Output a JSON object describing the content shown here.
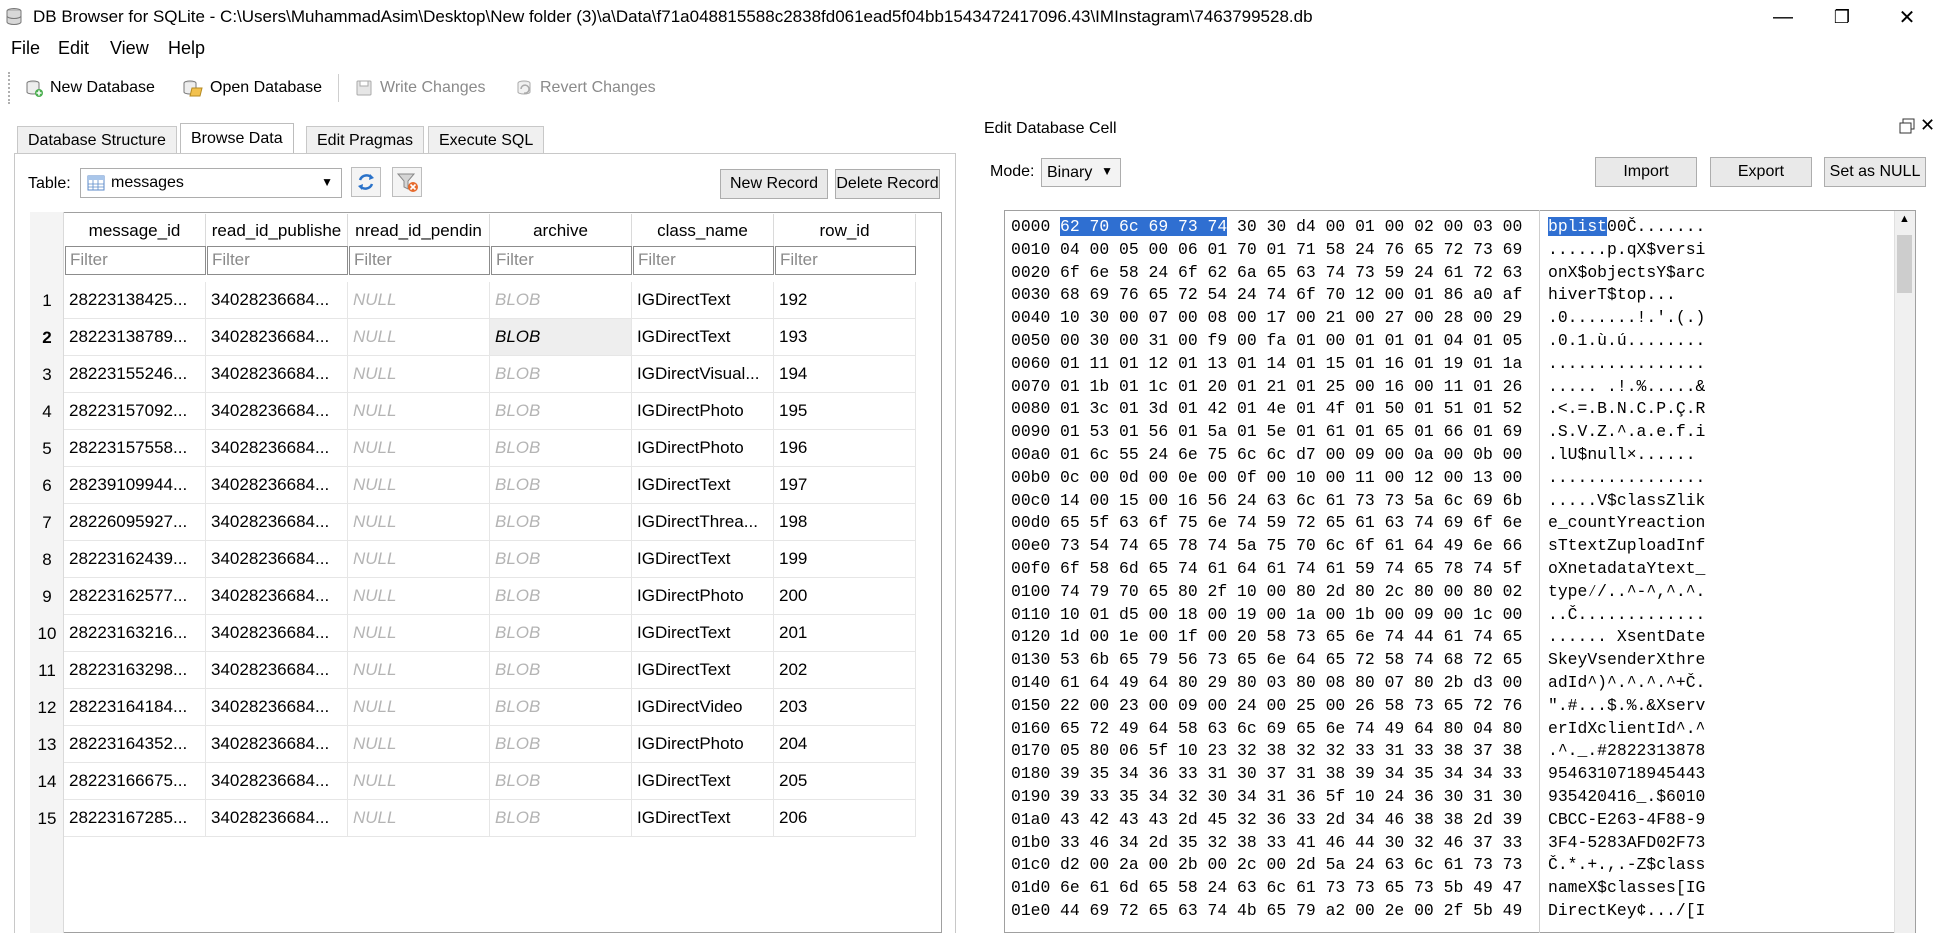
{
  "window": {
    "title": "DB Browser for SQLite - C:\\Users\\MuhammadAsim\\Desktop\\New folder (3)\\a\\Data\\f71a048815588c2838fd061ead5f04bb1543472417096.43\\IMInstagram\\7463799528.db",
    "minimize": "—",
    "maximize": "❐",
    "close": "✕"
  },
  "menu": {
    "file": "File",
    "edit": "Edit",
    "view": "View",
    "help": "Help"
  },
  "toolbar": {
    "new_database": "New Database",
    "open_database": "Open Database",
    "write_changes": "Write Changes",
    "revert_changes": "Revert Changes"
  },
  "tabs": {
    "structure": "Database Structure",
    "browse": "Browse Data",
    "pragmas": "Edit Pragmas",
    "sql": "Execute SQL"
  },
  "browse": {
    "table_label": "Table:",
    "table_value": "messages",
    "new_record": "New Record",
    "delete_record": "Delete Record",
    "columns": [
      "message_id",
      "read_id_publishe",
      "nread_id_pendin",
      "archive",
      "class_name",
      "row_id"
    ],
    "filter_placeholder": "Filter",
    "rows": [
      {
        "n": "1",
        "message_id": "28223138425...",
        "read_id": "34028236684...",
        "pending": "NULL",
        "archive": "BLOB",
        "class_name": "IGDirectText",
        "row_id": "192"
      },
      {
        "n": "2",
        "message_id": "28223138789...",
        "read_id": "34028236684...",
        "pending": "NULL",
        "archive": "BLOB",
        "class_name": "IGDirectText",
        "row_id": "193"
      },
      {
        "n": "3",
        "message_id": "28223155246...",
        "read_id": "34028236684...",
        "pending": "NULL",
        "archive": "BLOB",
        "class_name": "IGDirectVisual...",
        "row_id": "194"
      },
      {
        "n": "4",
        "message_id": "28223157092...",
        "read_id": "34028236684...",
        "pending": "NULL",
        "archive": "BLOB",
        "class_name": "IGDirectPhoto",
        "row_id": "195"
      },
      {
        "n": "5",
        "message_id": "28223157558...",
        "read_id": "34028236684...",
        "pending": "NULL",
        "archive": "BLOB",
        "class_name": "IGDirectPhoto",
        "row_id": "196"
      },
      {
        "n": "6",
        "message_id": "28239109944...",
        "read_id": "34028236684...",
        "pending": "NULL",
        "archive": "BLOB",
        "class_name": "IGDirectText",
        "row_id": "197"
      },
      {
        "n": "7",
        "message_id": "28226095927...",
        "read_id": "34028236684...",
        "pending": "NULL",
        "archive": "BLOB",
        "class_name": "IGDirectThrea...",
        "row_id": "198"
      },
      {
        "n": "8",
        "message_id": "28223162439...",
        "read_id": "34028236684...",
        "pending": "NULL",
        "archive": "BLOB",
        "class_name": "IGDirectText",
        "row_id": "199"
      },
      {
        "n": "9",
        "message_id": "28223162577...",
        "read_id": "34028236684...",
        "pending": "NULL",
        "archive": "BLOB",
        "class_name": "IGDirectPhoto",
        "row_id": "200"
      },
      {
        "n": "10",
        "message_id": "28223163216...",
        "read_id": "34028236684...",
        "pending": "NULL",
        "archive": "BLOB",
        "class_name": "IGDirectText",
        "row_id": "201"
      },
      {
        "n": "11",
        "message_id": "28223163298...",
        "read_id": "34028236684...",
        "pending": "NULL",
        "archive": "BLOB",
        "class_name": "IGDirectText",
        "row_id": "202"
      },
      {
        "n": "12",
        "message_id": "28223164184...",
        "read_id": "34028236684...",
        "pending": "NULL",
        "archive": "BLOB",
        "class_name": "IGDirectVideo",
        "row_id": "203"
      },
      {
        "n": "13",
        "message_id": "28223164352...",
        "read_id": "34028236684...",
        "pending": "NULL",
        "archive": "BLOB",
        "class_name": "IGDirectPhoto",
        "row_id": "204"
      },
      {
        "n": "14",
        "message_id": "28223166675...",
        "read_id": "34028236684...",
        "pending": "NULL",
        "archive": "BLOB",
        "class_name": "IGDirectText",
        "row_id": "205"
      },
      {
        "n": "15",
        "message_id": "28223167285...",
        "read_id": "34028236684...",
        "pending": "NULL",
        "archive": "BLOB",
        "class_name": "IGDirectText",
        "row_id": "206"
      }
    ],
    "current_row": "2"
  },
  "edit_cell": {
    "title": "Edit Database Cell",
    "mode_label": "Mode:",
    "mode_value": "Binary",
    "import": "Import",
    "export": "Export",
    "set_null": "Set as NULL",
    "hex": [
      {
        "addr": "0000",
        "sel": "62 70 6c 69 73 74",
        "bytes": " 30 30 d4 00 01 00 02 00 03 00",
        "asel": "bplist",
        "ascii": "00Č......."
      },
      {
        "addr": "0010",
        "bytes": "04 00 05 00 06 01 70 01 71 58 24 76 65 72 73 69",
        "ascii": "......p.qX$versi"
      },
      {
        "addr": "0020",
        "bytes": "6f 6e 58 24 6f 62 6a 65 63 74 73 59 24 61 72 63",
        "ascii": "onX$objectsY$arc"
      },
      {
        "addr": "0030",
        "bytes": "68 69 76 65 72 54 24 74 6f 70 12 00 01 86 a0 af",
        "ascii": "hiverT$top..."
      },
      {
        "addr": "0040",
        "bytes": "10 30 00 07 00 08 00 17 00 21 00 27 00 28 00 29",
        "ascii": ".0.......!.'.(.)"
      },
      {
        "addr": "0050",
        "bytes": "00 30 00 31 00 f9 00 fa 01 00 01 01 01 04 01 05",
        "ascii": ".0.1.ù.ú........"
      },
      {
        "addr": "0060",
        "bytes": "01 11 01 12 01 13 01 14 01 15 01 16 01 19 01 1a",
        "ascii": "................"
      },
      {
        "addr": "0070",
        "bytes": "01 1b 01 1c 01 20 01 21 01 25 00 16 00 11 01 26",
        "ascii": "..... .!.%.....&"
      },
      {
        "addr": "0080",
        "bytes": "01 3c 01 3d 01 42 01 4e 01 4f 01 50 01 51 01 52",
        "ascii": ".<.=.B.N.C.P.Ç.R"
      },
      {
        "addr": "0090",
        "bytes": "01 53 01 56 01 5a 01 5e 01 61 01 65 01 66 01 69",
        "ascii": ".S.V.Z.^.a.e.f.i"
      },
      {
        "addr": "00a0",
        "bytes": "01 6c 55 24 6e 75 6c 6c d7 00 09 00 0a 00 0b 00",
        "ascii": ".lU$null×......"
      },
      {
        "addr": "00b0",
        "bytes": "0c 00 0d 00 0e 00 0f 00 10 00 11 00 12 00 13 00",
        "ascii": "................"
      },
      {
        "addr": "00c0",
        "bytes": "14 00 15 00 16 56 24 63 6c 61 73 73 5a 6c 69 6b",
        "ascii": ".....V$classZlik"
      },
      {
        "addr": "00d0",
        "bytes": "65 5f 63 6f 75 6e 74 59 72 65 61 63 74 69 6f 6e",
        "ascii": "e_countYreaction"
      },
      {
        "addr": "00e0",
        "bytes": "73 54 74 65 78 74 5a 75 70 6c 6f 61 64 49 6e 66",
        "ascii": "sTtextZuploadInf"
      },
      {
        "addr": "00f0",
        "bytes": "6f 58 6d 65 74 61 64 61 74 61 59 74 65 78 74 5f",
        "ascii": "oXnetadataYtext_"
      },
      {
        "addr": "0100",
        "bytes": "74 79 70 65 80 2f 10 00 80 2d 80 2c 80 00 80 02",
        "ascii": "type⁄/..^-^,^.^."
      },
      {
        "addr": "0110",
        "bytes": "10 01 d5 00 18 00 19 00 1a 00 1b 00 09 00 1c 00",
        "ascii": "..Č............."
      },
      {
        "addr": "0120",
        "bytes": "1d 00 1e 00 1f 00 20 58 73 65 6e 74 44 61 74 65",
        "ascii": "...... XsentDate"
      },
      {
        "addr": "0130",
        "bytes": "53 6b 65 79 56 73 65 6e 64 65 72 58 74 68 72 65",
        "ascii": "SkeyVsenderXthre"
      },
      {
        "addr": "0140",
        "bytes": "61 64 49 64 80 29 80 03 80 08 80 07 80 2b d3 00",
        "ascii": "adId^)^.^.^.^+Č."
      },
      {
        "addr": "0150",
        "bytes": "22 00 23 00 09 00 24 00 25 00 26 58 73 65 72 76",
        "ascii": "\".#...$.%.&Xserv"
      },
      {
        "addr": "0160",
        "bytes": "65 72 49 64 58 63 6c 69 65 6e 74 49 64 80 04 80",
        "ascii": "erIdXclientId^.^"
      },
      {
        "addr": "0170",
        "bytes": "05 80 06 5f 10 23 32 38 32 32 33 31 33 38 37 38",
        "ascii": ".^._.#2822313878"
      },
      {
        "addr": "0180",
        "bytes": "39 35 34 36 33 31 30 37 31 38 39 34 35 34 34 33",
        "ascii": "9546310718945443"
      },
      {
        "addr": "0190",
        "bytes": "39 33 35 34 32 30 34 31 36 5f 10 24 36 30 31 30",
        "ascii": "935420416_.$6010"
      },
      {
        "addr": "01a0",
        "bytes": "43 42 43 43 2d 45 32 36 33 2d 34 46 38 38 2d 39",
        "ascii": "CBCC-E263-4F88-9"
      },
      {
        "addr": "01b0",
        "bytes": "33 46 34 2d 35 32 38 33 41 46 44 30 32 46 37 33",
        "ascii": "3F4-5283AFD02F73"
      },
      {
        "addr": "01c0",
        "bytes": "d2 00 2a 00 2b 00 2c 00 2d 5a 24 63 6c 61 73 73",
        "ascii": "Č.*.+.,.-Z$class"
      },
      {
        "addr": "01d0",
        "bytes": "6e 61 6d 65 58 24 63 6c 61 73 73 65 73 5b 49 47",
        "ascii": "nameX$classes[IG"
      },
      {
        "addr": "01e0",
        "bytes": "44 69 72 65 63 74 4b 65 79 a2 00 2e 00 2f 5b 49",
        "ascii": "DirectKey¢.../[I"
      }
    ]
  }
}
